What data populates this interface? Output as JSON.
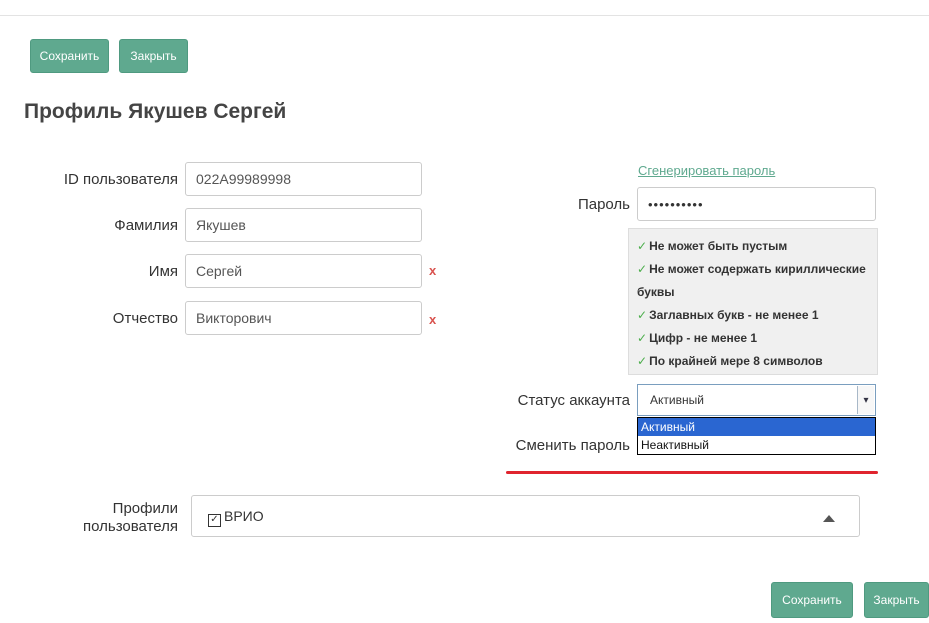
{
  "toolbar_top": {
    "save_label": "Сохранить",
    "close_label": "Закрыть"
  },
  "title": "Профиль Якушев Сергей",
  "fields": {
    "user_id": {
      "label": "ID пользователя",
      "value": "022A99989998"
    },
    "last_name": {
      "label": "Фамилия",
      "value": "Якушев"
    },
    "first_name": {
      "label": "Имя",
      "value": "Сергей",
      "error": "x"
    },
    "middle_name": {
      "label": "Отчество",
      "value": "Викторович",
      "error": "x"
    }
  },
  "password": {
    "generate_link": "Сгенерировать пароль",
    "label": "Пароль",
    "value": "••••••••••",
    "rules": [
      "Не может быть пустым",
      "Не может содержать кириллические буквы",
      "Заглавных букв - не менее 1",
      "Цифр - не менее 1",
      "По крайней мере 8 символов"
    ]
  },
  "account_status": {
    "label": "Статус аккаунта",
    "selected": "Активный",
    "options": [
      "Активный",
      "Неактивный"
    ]
  },
  "change_password": {
    "label": "Сменить пароль"
  },
  "profiles": {
    "label_line1": "Профили",
    "label_line2": "пользователя",
    "chip": "ВРИО"
  },
  "toolbar_bottom": {
    "save_label": "Сохранить",
    "close_label": "Закрыть"
  },
  "colors": {
    "accent": "#5fa98f",
    "error": "#d9534f",
    "highlight": "#e0242e",
    "selected_option": "#2a66d1"
  }
}
